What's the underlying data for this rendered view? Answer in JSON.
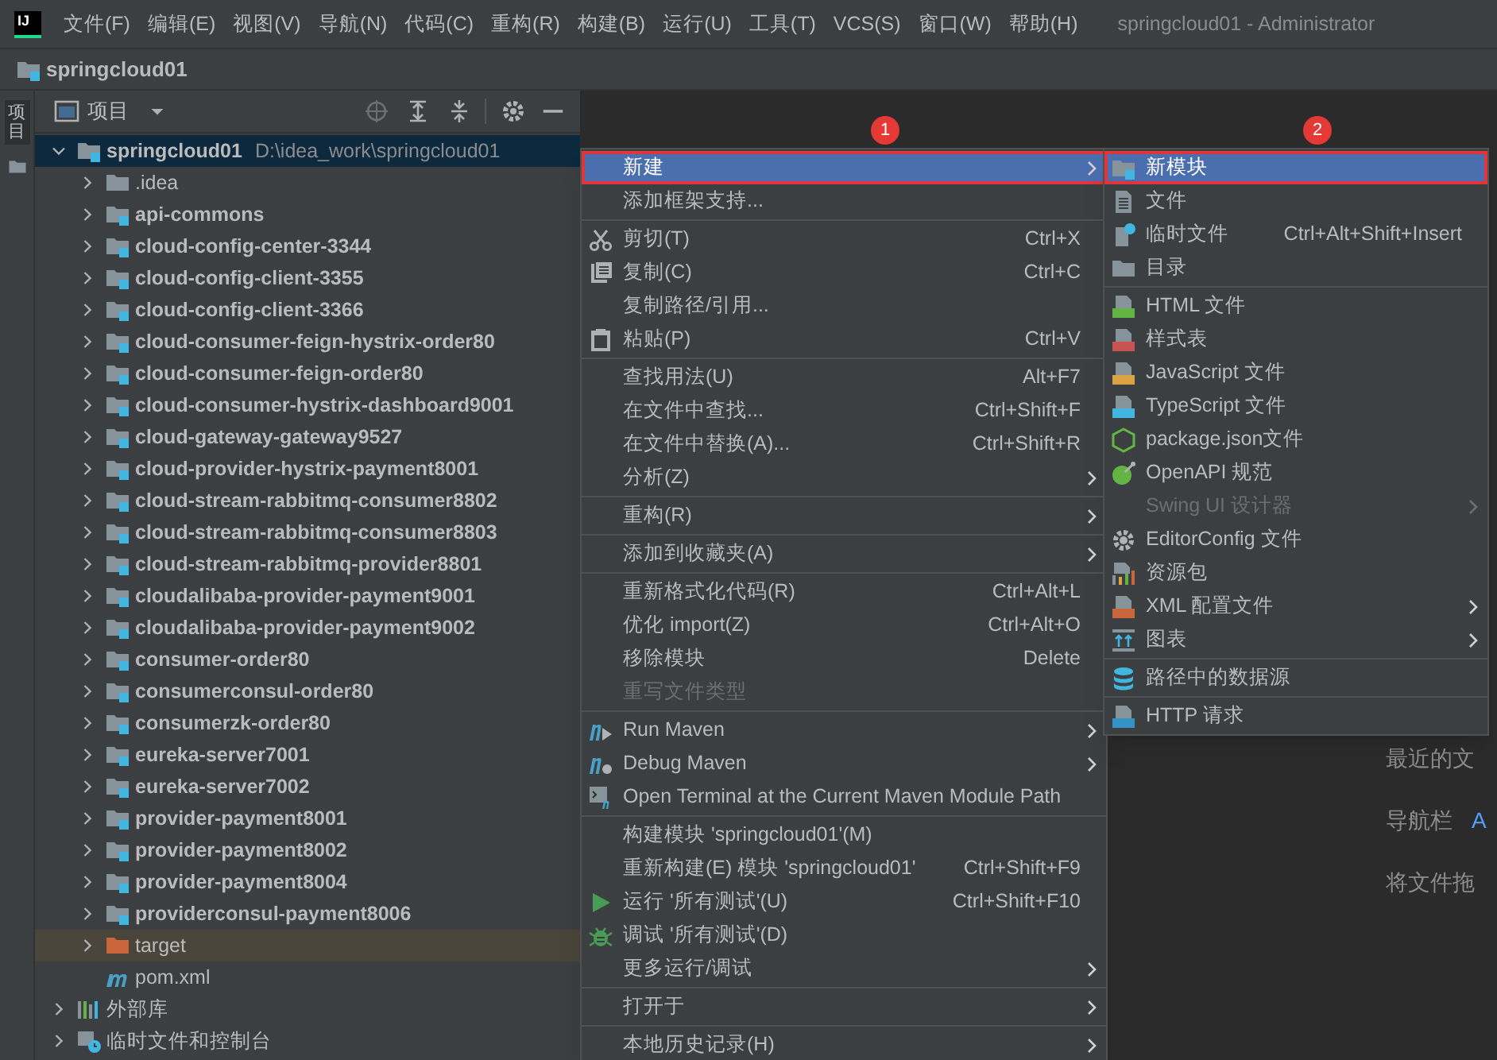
{
  "menu_bar": {
    "logo": "IJ",
    "items": [
      "文件(F)",
      "编辑(E)",
      "视图(V)",
      "导航(N)",
      "代码(C)",
      "重构(R)",
      "构建(B)",
      "运行(U)",
      "工具(T)",
      "VCS(S)",
      "窗口(W)",
      "帮助(H)"
    ],
    "title": "springcloud01 - Administrator"
  },
  "nav_bar": {
    "breadcrumb": "springcloud01"
  },
  "tool_strip": {
    "tab": "项目"
  },
  "project_panel": {
    "title": "项目",
    "tree": [
      {
        "label": "springcloud01",
        "path": "D:\\idea_work\\springcloud01",
        "kind": "module",
        "expanded": true,
        "selected": true,
        "children": [
          {
            "label": ".idea",
            "kind": "folder",
            "expanded": false,
            "selected": false
          },
          {
            "label": "api-commons",
            "kind": "module",
            "expanded": false,
            "selected": false
          },
          {
            "label": "cloud-config-center-3344",
            "kind": "module",
            "expanded": false,
            "selected": false
          },
          {
            "label": "cloud-config-client-3355",
            "kind": "module",
            "expanded": false,
            "selected": false
          },
          {
            "label": "cloud-config-client-3366",
            "kind": "module",
            "expanded": false,
            "selected": false
          },
          {
            "label": "cloud-consumer-feign-hystrix-order80",
            "kind": "module",
            "expanded": false,
            "selected": false
          },
          {
            "label": "cloud-consumer-feign-order80",
            "kind": "module",
            "expanded": false,
            "selected": false
          },
          {
            "label": "cloud-consumer-hystrix-dashboard9001",
            "kind": "module",
            "expanded": false,
            "selected": false
          },
          {
            "label": "cloud-gateway-gateway9527",
            "kind": "module",
            "expanded": false,
            "selected": false
          },
          {
            "label": "cloud-provider-hystrix-payment8001",
            "kind": "module",
            "expanded": false,
            "selected": false
          },
          {
            "label": "cloud-stream-rabbitmq-consumer8802",
            "kind": "module",
            "expanded": false,
            "selected": false
          },
          {
            "label": "cloud-stream-rabbitmq-consumer8803",
            "kind": "module",
            "expanded": false,
            "selected": false
          },
          {
            "label": "cloud-stream-rabbitmq-provider8801",
            "kind": "module",
            "expanded": false,
            "selected": false
          },
          {
            "label": "cloudalibaba-provider-payment9001",
            "kind": "module",
            "expanded": false,
            "selected": false
          },
          {
            "label": "cloudalibaba-provider-payment9002",
            "kind": "module",
            "expanded": false,
            "selected": false
          },
          {
            "label": "consumer-order80",
            "kind": "module",
            "expanded": false,
            "selected": false
          },
          {
            "label": "consumerconsul-order80",
            "kind": "module",
            "expanded": false,
            "selected": false
          },
          {
            "label": "consumerzk-order80",
            "kind": "module",
            "expanded": false,
            "selected": false
          },
          {
            "label": "eureka-server7001",
            "kind": "module",
            "expanded": false,
            "selected": false
          },
          {
            "label": "eureka-server7002",
            "kind": "module",
            "expanded": false,
            "selected": false
          },
          {
            "label": "provider-payment8001",
            "kind": "module",
            "expanded": false,
            "selected": false
          },
          {
            "label": "provider-payment8002",
            "kind": "module",
            "expanded": false,
            "selected": false
          },
          {
            "label": "provider-payment8004",
            "kind": "module",
            "expanded": false,
            "selected": false
          },
          {
            "label": "providerconsul-payment8006",
            "kind": "module",
            "expanded": false,
            "selected": false
          },
          {
            "label": "target",
            "kind": "excluded",
            "expanded": false,
            "selected": false
          },
          {
            "label": "pom.xml",
            "kind": "maven",
            "selected": false
          }
        ]
      },
      {
        "label": "外部库",
        "kind": "libraries",
        "expanded": false,
        "selected": false
      },
      {
        "label": "临时文件和控制台",
        "kind": "scratches",
        "expanded": false,
        "selected": false
      }
    ]
  },
  "context_menu": {
    "groups": [
      {
        "items": [
          {
            "label": "新建",
            "submenu": true,
            "disabled": false,
            "selected": true
          },
          {
            "label": "添加框架支持...",
            "submenu": false,
            "disabled": false,
            "selected": false
          }
        ]
      },
      {
        "items": [
          {
            "label": "剪切(T)",
            "kind": "scissors",
            "shortcut": "Ctrl+X",
            "submenu": false,
            "disabled": false,
            "selected": false
          },
          {
            "label": "复制(C)",
            "kind": "copy",
            "shortcut": "Ctrl+C",
            "submenu": false,
            "disabled": false,
            "selected": false
          },
          {
            "label": "复制路径/引用...",
            "submenu": false,
            "disabled": false,
            "selected": false
          },
          {
            "label": "粘贴(P)",
            "kind": "paste",
            "shortcut": "Ctrl+V",
            "submenu": false,
            "disabled": false,
            "selected": false
          }
        ]
      },
      {
        "items": [
          {
            "label": "查找用法(U)",
            "shortcut": "Alt+F7",
            "submenu": false,
            "disabled": false,
            "selected": false
          },
          {
            "label": "在文件中查找...",
            "shortcut": "Ctrl+Shift+F",
            "submenu": false,
            "disabled": false,
            "selected": false
          },
          {
            "label": "在文件中替换(A)...",
            "shortcut": "Ctrl+Shift+R",
            "submenu": false,
            "disabled": false,
            "selected": false
          },
          {
            "label": "分析(Z)",
            "submenu": true,
            "disabled": false,
            "selected": false
          }
        ]
      },
      {
        "items": [
          {
            "label": "重构(R)",
            "submenu": true,
            "disabled": false,
            "selected": false
          }
        ]
      },
      {
        "items": [
          {
            "label": "添加到收藏夹(A)",
            "submenu": true,
            "disabled": false,
            "selected": false
          }
        ]
      },
      {
        "items": [
          {
            "label": "重新格式化代码(R)",
            "shortcut": "Ctrl+Alt+L",
            "submenu": false,
            "disabled": false,
            "selected": false
          },
          {
            "label": "优化 import(Z)",
            "shortcut": "Ctrl+Alt+O",
            "submenu": false,
            "disabled": false,
            "selected": false
          },
          {
            "label": "移除模块",
            "shortcut": "Delete",
            "submenu": false,
            "disabled": false,
            "selected": false
          },
          {
            "label": "重写文件类型",
            "submenu": false,
            "disabled": true,
            "selected": false
          }
        ]
      },
      {
        "items": [
          {
            "label": "Run Maven",
            "kind": "maven-run",
            "submenu": true,
            "disabled": false,
            "selected": false
          },
          {
            "label": "Debug Maven",
            "kind": "maven-debug",
            "submenu": true,
            "disabled": false,
            "selected": false
          },
          {
            "label": "Open Terminal at the Current Maven Module Path",
            "kind": "terminal",
            "submenu": false,
            "disabled": false,
            "selected": false
          }
        ]
      },
      {
        "items": [
          {
            "label": "构建模块 'springcloud01'(M)",
            "submenu": false,
            "disabled": false,
            "selected": false
          },
          {
            "label": "重新构建(E) 模块 'springcloud01'",
            "shortcut": "Ctrl+Shift+F9",
            "submenu": false,
            "disabled": false,
            "selected": false
          },
          {
            "label": "运行 '所有测试'(U)",
            "kind": "run",
            "shortcut": "Ctrl+Shift+F10",
            "submenu": false,
            "disabled": false,
            "selected": false
          },
          {
            "label": "调试 '所有测试'(D)",
            "kind": "debug",
            "submenu": false,
            "disabled": false,
            "selected": false
          },
          {
            "label": "更多运行/调试",
            "submenu": true,
            "disabled": false,
            "selected": false
          }
        ]
      },
      {
        "items": [
          {
            "label": "打开于",
            "submenu": true,
            "disabled": false,
            "selected": false
          }
        ]
      },
      {
        "items": [
          {
            "label": "本地历史记录(H)",
            "submenu": true,
            "disabled": false,
            "selected": false
          }
        ]
      }
    ]
  },
  "new_submenu": {
    "groups": [
      {
        "items": [
          {
            "label": "新模块",
            "kind": "module-folder",
            "submenu": false,
            "disabled": false,
            "selected": true
          },
          {
            "label": "文件",
            "kind": "file",
            "submenu": false,
            "disabled": false,
            "selected": false
          },
          {
            "label": "临时文件",
            "kind": "scratch",
            "shortcut": "Ctrl+Alt+Shift+Insert",
            "submenu": false,
            "disabled": false,
            "selected": false
          },
          {
            "label": "目录",
            "kind": "folder",
            "submenu": false,
            "disabled": false,
            "selected": false
          }
        ]
      },
      {
        "items": [
          {
            "label": "HTML 文件",
            "kind": "html",
            "submenu": false,
            "disabled": false,
            "selected": false
          },
          {
            "label": "样式表",
            "kind": "css",
            "submenu": false,
            "disabled": false,
            "selected": false
          },
          {
            "label": "JavaScript 文件",
            "kind": "js",
            "submenu": false,
            "disabled": false,
            "selected": false
          },
          {
            "label": "TypeScript 文件",
            "kind": "ts",
            "submenu": false,
            "disabled": false,
            "selected": false
          },
          {
            "label": "package.json文件",
            "kind": "nodejs",
            "submenu": false,
            "disabled": false,
            "selected": false
          },
          {
            "label": "OpenAPI 规范",
            "kind": "openapi",
            "submenu": false,
            "disabled": false,
            "selected": false
          },
          {
            "label": "Swing UI 设计器",
            "submenu": true,
            "disabled": true,
            "selected": false
          },
          {
            "label": "EditorConfig 文件",
            "kind": "gear",
            "submenu": false,
            "disabled": false,
            "selected": false
          },
          {
            "label": "资源包",
            "kind": "bundle",
            "submenu": false,
            "disabled": false,
            "selected": false
          },
          {
            "label": "XML 配置文件",
            "kind": "xml",
            "submenu": true,
            "disabled": false,
            "selected": false
          },
          {
            "label": "图表",
            "kind": "diagram",
            "submenu": true,
            "disabled": false,
            "selected": false
          }
        ]
      },
      {
        "items": [
          {
            "label": "路径中的数据源",
            "kind": "database",
            "submenu": false,
            "disabled": false,
            "selected": false
          }
        ]
      },
      {
        "items": [
          {
            "label": "HTTP 请求",
            "kind": "api",
            "submenu": false,
            "disabled": false,
            "selected": false
          }
        ]
      }
    ]
  },
  "editor": {
    "hints": [
      {
        "label": "最近的文"
      },
      {
        "label": "导航栏",
        "shortcut": "A"
      },
      {
        "label": "将文件拖"
      }
    ]
  },
  "annotations": [
    {
      "label": "1"
    },
    {
      "label": "2"
    }
  ]
}
